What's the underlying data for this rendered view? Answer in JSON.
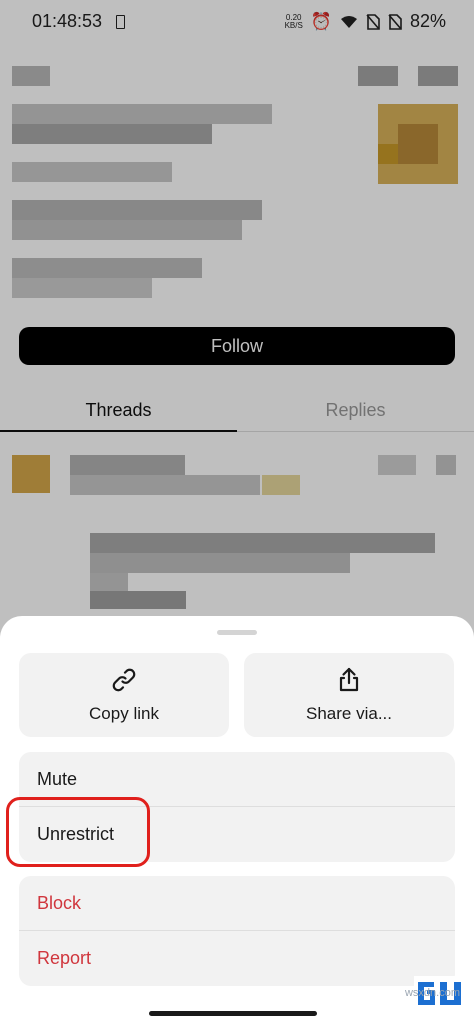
{
  "status_bar": {
    "time": "01:48:53",
    "net_speed_value": "0.20",
    "net_speed_unit": "KB/S",
    "battery_percent": "82%",
    "icons": [
      "battery-saver-icon",
      "alarm-icon",
      "wifi-icon",
      "no-sim-icon",
      "no-sim-icon",
      "battery-icon"
    ]
  },
  "profile": {
    "follow_label": "Follow",
    "tabs": [
      {
        "label": "Threads",
        "active": true
      },
      {
        "label": "Replies",
        "active": false
      }
    ]
  },
  "sheet": {
    "actions": [
      {
        "label": "Copy link",
        "icon": "link-icon"
      },
      {
        "label": "Share via...",
        "icon": "share-icon"
      }
    ],
    "group1": [
      {
        "label": "Mute"
      },
      {
        "label": "Unrestrict"
      }
    ],
    "group2": [
      {
        "label": "Block"
      },
      {
        "label": "Report"
      }
    ]
  },
  "watermark": {
    "logo": "GU",
    "text": "wsxdn.com"
  },
  "colors": {
    "danger": "#d0363d",
    "highlight": "#e0201c",
    "button_dark": "#000000",
    "sheet_card": "#f2f2f2"
  }
}
